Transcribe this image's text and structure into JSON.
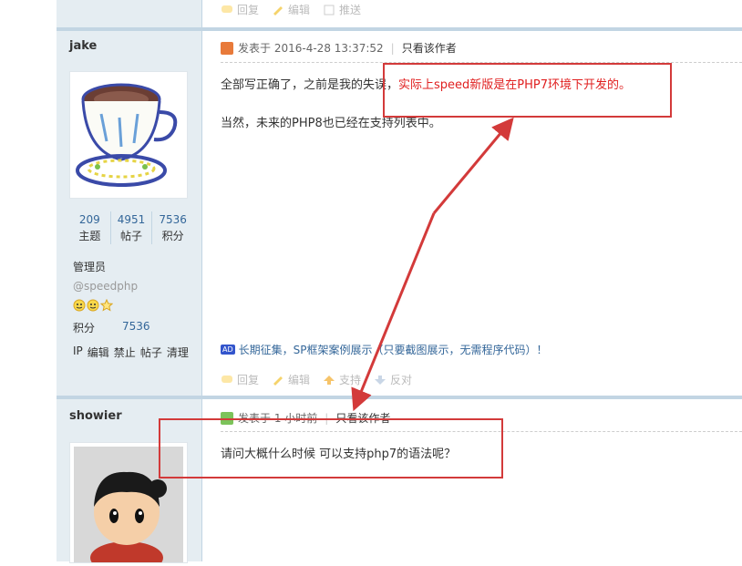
{
  "top_actions": {
    "reply": "回复",
    "edit": "编辑",
    "push": "推送"
  },
  "post1": {
    "author": "jake",
    "stats": [
      {
        "num": "209",
        "label": "主题"
      },
      {
        "num": "4951",
        "label": "帖子"
      },
      {
        "num": "7536",
        "label": "积分"
      }
    ],
    "role": "管理员",
    "handle": "@speedphp",
    "credit_label": "积分",
    "credit_value": "7536",
    "manage_links": {
      "ip": "IP",
      "edit": "编辑",
      "ban": "禁止",
      "posts": "帖子",
      "clean": "清理"
    },
    "posted_prefix": "发表于",
    "posted_time": "2016-4-28 13:37:52",
    "only_author": "只看该作者",
    "line1_normal": "全部写正确了，之前是我的失误，",
    "line1_red": "实际上speed新版是在PHP7环境下开发的。",
    "line2": "当然，未来的PHP8也已经在支持列表中。",
    "ad_badge": "AD",
    "ad_text": "长期征集，SP框架案例展示（只要截图展示，无需程序代码）！",
    "actions": {
      "reply": "回复",
      "edit": "编辑",
      "support": "支持",
      "oppose": "反对"
    }
  },
  "post2": {
    "author": "showier",
    "posted_prefix": "发表于",
    "posted_time": "1 小时前",
    "only_author": "只看该作者",
    "line1": "请问大概什么时候 可以支持php7的语法呢？"
  },
  "colors": {
    "accent_red": "#e02020",
    "annotation_red": "#d33a3a",
    "sidebar_bg": "#e5edf2",
    "link_blue": "#336699"
  }
}
